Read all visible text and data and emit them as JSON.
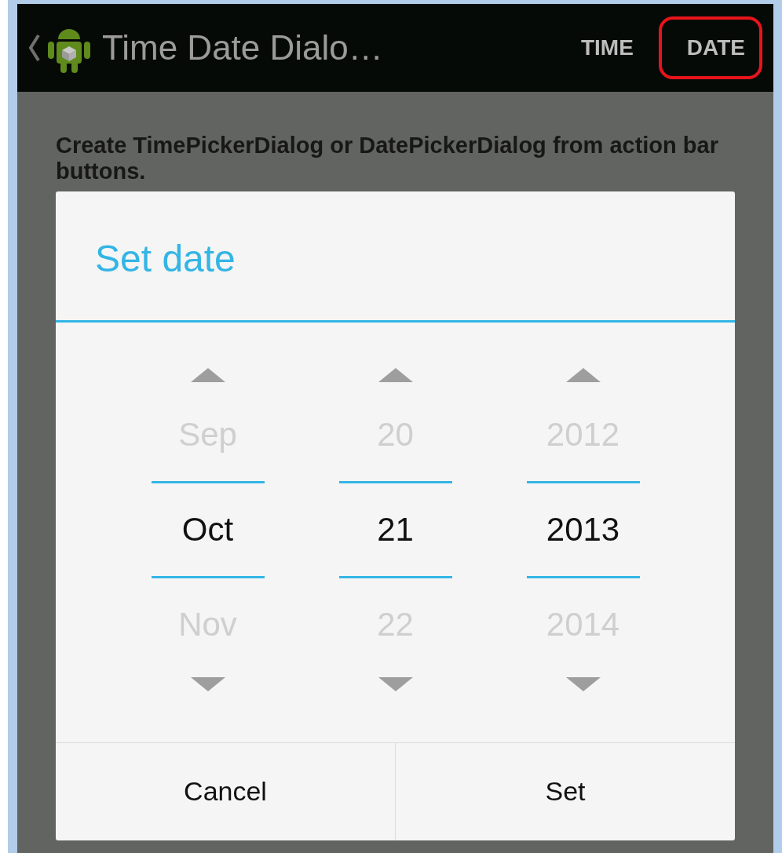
{
  "action_bar": {
    "title": "Time Date Dialo…",
    "actions": [
      {
        "label": "TIME",
        "highlighted": false
      },
      {
        "label": "DATE",
        "highlighted": true
      }
    ]
  },
  "description": "Create TimePickerDialog or DatePickerDialog from action bar buttons.",
  "dialog": {
    "title": "Set date",
    "pickers": [
      {
        "previous": "Sep",
        "value": "Oct",
        "next": "Nov"
      },
      {
        "previous": "20",
        "value": "21",
        "next": "22"
      },
      {
        "previous": "2012",
        "value": "2013",
        "next": "2014"
      }
    ],
    "buttons": [
      "Cancel",
      "Set"
    ]
  }
}
